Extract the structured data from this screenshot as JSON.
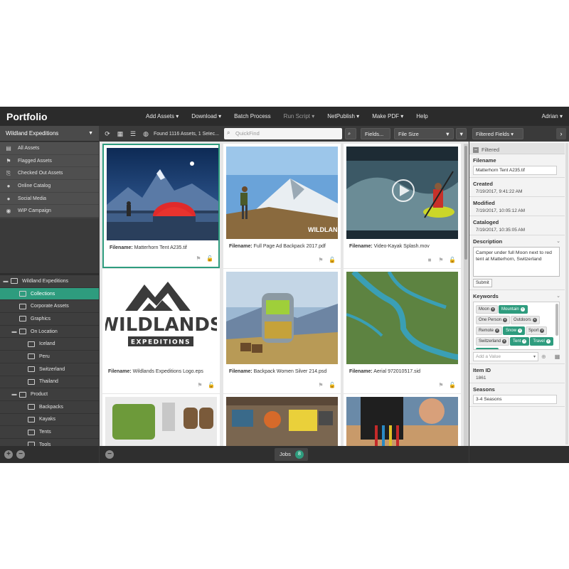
{
  "app": {
    "logo": "Portfolio",
    "user": "Adrian ▾"
  },
  "menu": [
    {
      "label": "Add Assets ▾",
      "dim": false
    },
    {
      "label": "Download ▾",
      "dim": false
    },
    {
      "label": "Batch Process",
      "dim": false
    },
    {
      "label": "Run Script ▾",
      "dim": true
    },
    {
      "label": "NetPublish ▾",
      "dim": false
    },
    {
      "label": "Make PDF ▾",
      "dim": false
    },
    {
      "label": "Help",
      "dim": false
    }
  ],
  "sidebar": {
    "catalog": "Wildland Expeditions",
    "views": [
      {
        "icon": "all-assets-icon",
        "glyph": "▤",
        "label": "All Assets"
      },
      {
        "icon": "flag-icon",
        "glyph": "⚑",
        "label": "Flagged Assets"
      },
      {
        "icon": "checked-out-icon",
        "glyph": "⎘",
        "label": "Checked Out Assets"
      },
      {
        "icon": "user-icon",
        "glyph": "●",
        "label": "Online Catalog"
      },
      {
        "icon": "user-icon",
        "glyph": "●",
        "label": "Social Media"
      },
      {
        "icon": "eye-icon",
        "glyph": "◉",
        "label": "WIP Campaign"
      }
    ],
    "tree": [
      {
        "label": "Wildland Expeditions",
        "indent": 0,
        "toggle": "▬",
        "selected": false
      },
      {
        "label": "Collections",
        "indent": 1,
        "toggle": "",
        "selected": true
      },
      {
        "label": "Corporate Assets",
        "indent": 1,
        "toggle": "",
        "selected": false
      },
      {
        "label": "Graphics",
        "indent": 1,
        "toggle": "",
        "selected": false
      },
      {
        "label": "On Location",
        "indent": 1,
        "toggle": "▬",
        "selected": false
      },
      {
        "label": "Iceland",
        "indent": 2,
        "toggle": "",
        "selected": false
      },
      {
        "label": "Peru",
        "indent": 2,
        "toggle": "",
        "selected": false
      },
      {
        "label": "Switzerland",
        "indent": 2,
        "toggle": "",
        "selected": false
      },
      {
        "label": "Thailand",
        "indent": 2,
        "toggle": "",
        "selected": false
      },
      {
        "label": "Product",
        "indent": 1,
        "toggle": "▬",
        "selected": false
      },
      {
        "label": "Backpacks",
        "indent": 2,
        "toggle": "",
        "selected": false
      },
      {
        "label": "Kayaks",
        "indent": 2,
        "toggle": "",
        "selected": false
      },
      {
        "label": "Tents",
        "indent": 2,
        "toggle": "",
        "selected": false
      },
      {
        "label": "Tools",
        "indent": 2,
        "toggle": "",
        "selected": false
      }
    ]
  },
  "toolbar": {
    "found": "Found 1116 Assets, 1 Selec...",
    "quickfind_placeholder": "QuickFind",
    "fields_label": "Fields...",
    "sort_label": "File Size"
  },
  "caption_prefix": "Filename:",
  "assets": [
    {
      "filename": "Matterhorn Tent A235.tif",
      "scene": "tent",
      "selected": true,
      "video": false
    },
    {
      "filename": "Full Page Ad Backpack 2017.pdf",
      "scene": "hiker",
      "selected": false,
      "video": false
    },
    {
      "filename": "Video-Kayak Splash.mov",
      "scene": "kayak",
      "selected": false,
      "video": true
    },
    {
      "filename": "Wildlands Expeditions Logo.eps",
      "scene": "logo",
      "selected": false,
      "video": false
    },
    {
      "filename": "Backpack Women Silver 214.psd",
      "scene": "backpack",
      "selected": false,
      "video": false
    },
    {
      "filename": "Aerial 972010517.sid",
      "scene": "aerial",
      "selected": false,
      "video": false
    },
    {
      "filename": "",
      "scene": "gear1",
      "selected": false,
      "video": false
    },
    {
      "filename": "",
      "scene": "gear2",
      "selected": false,
      "video": false
    },
    {
      "filename": "",
      "scene": "climb",
      "selected": false,
      "video": false
    }
  ],
  "logo_art": {
    "title": "WILDLANDS",
    "subtitle": "EXPEDITIONS"
  },
  "jobs": {
    "label": "Jobs",
    "count": "8"
  },
  "rpanel": {
    "selector": "Filtered Fields",
    "section": "Filtered",
    "filename_label": "Filename",
    "filename_value": "Matterhorn Tent A235.tif",
    "created_label": "Created",
    "created_value": "7/19/2017, 9:41:22 AM",
    "modified_label": "Modified",
    "modified_value": "7/19/2017, 10:05:12 AM",
    "cataloged_label": "Cataloged",
    "cataloged_value": "7/19/2017, 10:35:05 AM",
    "description_label": "Description",
    "description_value": "Camper under full Moon next to red tent at Matterhorn, Switzerland",
    "submit_label": "Submit",
    "keywords_label": "Keywords",
    "keywords": [
      {
        "label": "Moon",
        "green": false
      },
      {
        "label": "Mountain",
        "green": true
      },
      {
        "label": "One Person",
        "green": false
      },
      {
        "label": "Outdoors",
        "green": false
      },
      {
        "label": "Remote",
        "green": false
      },
      {
        "label": "Snow",
        "green": true
      },
      {
        "label": "Sport",
        "green": false
      },
      {
        "label": "Switzerland",
        "green": false
      },
      {
        "label": "Tent",
        "green": true
      },
      {
        "label": "Travel",
        "green": true
      },
      {
        "label": "Water",
        "green": true
      }
    ],
    "add_value_placeholder": "Add a Value",
    "item_id_label": "Item ID",
    "item_id_value": "1861",
    "seasons_label": "Seasons",
    "seasons_value": "3-4 Seasons"
  },
  "colors": {
    "accent": "#2e9c7e",
    "topbar": "#2b2b2b",
    "panel": "#3a3a3a"
  }
}
